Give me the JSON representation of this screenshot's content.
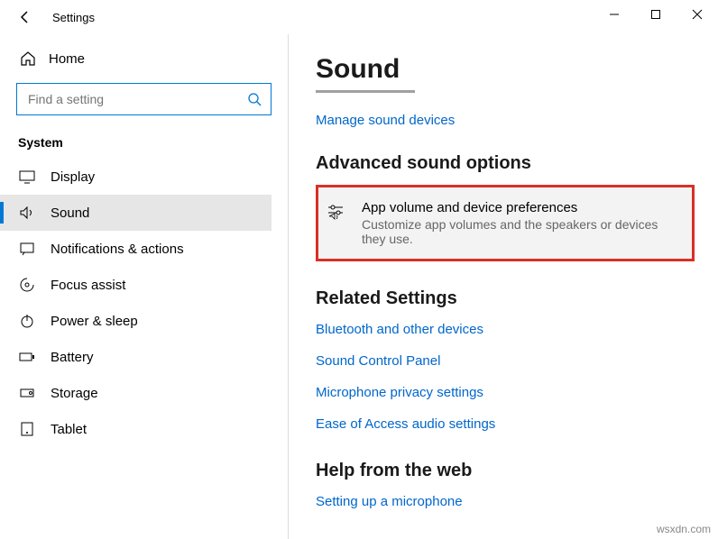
{
  "window": {
    "title": "Settings"
  },
  "sidebar": {
    "home_label": "Home",
    "search_placeholder": "Find a setting",
    "section_label": "System",
    "items": [
      {
        "label": "Display"
      },
      {
        "label": "Sound"
      },
      {
        "label": "Notifications & actions"
      },
      {
        "label": "Focus assist"
      },
      {
        "label": "Power & sleep"
      },
      {
        "label": "Battery"
      },
      {
        "label": "Storage"
      },
      {
        "label": "Tablet"
      }
    ]
  },
  "main": {
    "title": "Sound",
    "manage_link": "Manage sound devices",
    "advanced_header": "Advanced sound options",
    "option": {
      "title": "App volume and device preferences",
      "desc": "Customize app volumes and the speakers or devices they use."
    },
    "related_header": "Related Settings",
    "related_links": [
      "Bluetooth and other devices",
      "Sound Control Panel",
      "Microphone privacy settings",
      "Ease of Access audio settings"
    ],
    "help_header": "Help from the web",
    "help_link": "Setting up a microphone"
  },
  "watermark": "wsxdn.com"
}
